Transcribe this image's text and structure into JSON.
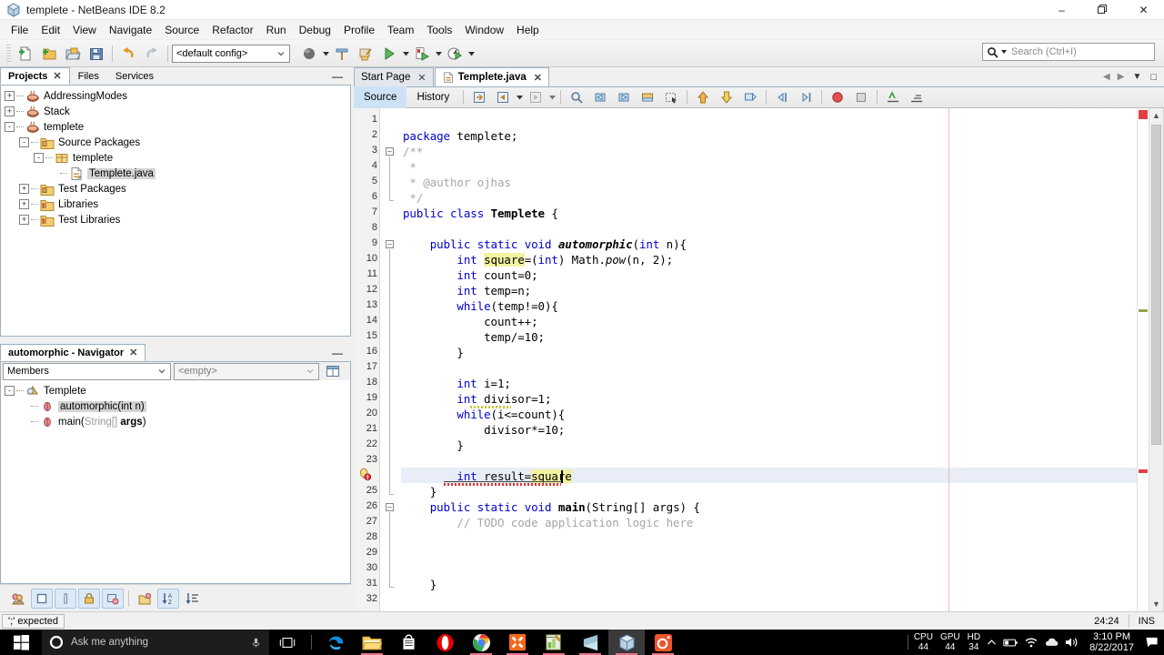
{
  "window": {
    "title": "templete - NetBeans IDE 8.2",
    "icon": "netbeans-cube-icon",
    "minimize": "–",
    "maximize": "❐",
    "close": "✕"
  },
  "menubar": {
    "items": [
      "File",
      "Edit",
      "View",
      "Navigate",
      "Source",
      "Refactor",
      "Run",
      "Debug",
      "Profile",
      "Team",
      "Tools",
      "Window",
      "Help"
    ]
  },
  "toolbar": {
    "config_value": "<default config>",
    "search_placeholder": "Search (Ctrl+I)",
    "buttons": [
      "new-file",
      "new-project",
      "open-project",
      "save-all",
      "undo",
      "redo"
    ]
  },
  "projects_panel": {
    "tabs": [
      {
        "label": "Projects",
        "active": true,
        "closable": true
      },
      {
        "label": "Files",
        "active": false,
        "closable": false
      },
      {
        "label": "Services",
        "active": false,
        "closable": false
      }
    ],
    "minimize": "—",
    "tree": [
      {
        "label": "AddressingModes",
        "indent": 0,
        "expander": "+",
        "icon": "java-project-icon",
        "selected": false
      },
      {
        "label": "Stack",
        "indent": 0,
        "expander": "+",
        "icon": "java-project-icon",
        "selected": false
      },
      {
        "label": "templete",
        "indent": 0,
        "expander": "-",
        "icon": "java-project-icon",
        "selected": false
      },
      {
        "label": "Source Packages",
        "indent": 1,
        "expander": "-",
        "icon": "source-packages-icon",
        "selected": false
      },
      {
        "label": "templete",
        "indent": 2,
        "expander": "-",
        "icon": "package-icon",
        "selected": false
      },
      {
        "label": "Templete.java",
        "indent": 3,
        "expander": "",
        "icon": "java-file-icon",
        "selected": true
      },
      {
        "label": "Test Packages",
        "indent": 1,
        "expander": "+",
        "icon": "test-packages-icon",
        "selected": false
      },
      {
        "label": "Libraries",
        "indent": 1,
        "expander": "+",
        "icon": "libraries-icon",
        "selected": false
      },
      {
        "label": "Test Libraries",
        "indent": 1,
        "expander": "+",
        "icon": "libraries-icon",
        "selected": false
      }
    ]
  },
  "navigator_panel": {
    "tab_label": "automorphic - Navigator",
    "minimize": "—",
    "scope_value": "Members",
    "filter_value": "<empty>",
    "tree": [
      {
        "label": "Templete",
        "indent": 0,
        "expander": "-",
        "icon": "class-icon",
        "selected": false,
        "type": "class"
      },
      {
        "label": "automorphic(int n)",
        "indent": 1,
        "expander": "",
        "icon": "method-icon",
        "selected": true,
        "type": "method"
      },
      {
        "label": "main(String[] args)",
        "indent": 1,
        "expander": "",
        "icon": "method-icon",
        "selected": false,
        "type": "method"
      }
    ],
    "bottom_buttons": [
      "filter-inherited-icon",
      "show-fields-icon",
      "show-constructors-icon",
      "show-protected-icon",
      "show-package-icon",
      "show-static-icon",
      "sort-alphabetically-icon",
      "sort-by-source-icon"
    ]
  },
  "editor": {
    "tabs": [
      {
        "label": "Start Page",
        "active": false,
        "icon": ""
      },
      {
        "label": "Templete.java",
        "active": true,
        "icon": "java-file-icon"
      }
    ],
    "view_buttons": [
      {
        "label": "Source",
        "active": true
      },
      {
        "label": "History",
        "active": false
      }
    ],
    "toolbar_icons": [
      "last-edit-icon",
      "back-icon",
      "forward-icon",
      "find-selection-icon",
      "previous-bookmark-icon",
      "next-bookmark-icon",
      "toggle-bookmark-icon",
      "select-rectangle-icon",
      "previous-error-icon",
      "next-error-icon",
      "toggle-highlight-icon",
      "shift-left-icon",
      "shift-right-icon",
      "toggle-breakpoint-icon",
      "stop-icon",
      "comment-icon",
      "uncomment-icon"
    ],
    "right_margin_column": 80
  },
  "code": {
    "language": "java",
    "first_line": 1,
    "last_visible_line": 32,
    "caret": "24:24",
    "insert_mode": "INS",
    "error_message": "';' expected",
    "error_line": 24,
    "current_line": 24,
    "highlighted_identifier": "square",
    "lines": [
      {
        "n": 1,
        "text": ""
      },
      {
        "n": 2,
        "text": "package templete;"
      },
      {
        "n": 3,
        "text": "/**"
      },
      {
        "n": 4,
        "text": " *"
      },
      {
        "n": 5,
        "text": " * @author ojhas"
      },
      {
        "n": 6,
        "text": " */"
      },
      {
        "n": 7,
        "text": "public class Templete {"
      },
      {
        "n": 8,
        "text": ""
      },
      {
        "n": 9,
        "text": "    public static void automorphic(int n){"
      },
      {
        "n": 10,
        "text": "        int square=(int) Math.pow(n, 2);"
      },
      {
        "n": 11,
        "text": "        int count=0;"
      },
      {
        "n": 12,
        "text": "        int temp=n;"
      },
      {
        "n": 13,
        "text": "        while(temp!=0){"
      },
      {
        "n": 14,
        "text": "            count++;"
      },
      {
        "n": 15,
        "text": "            temp/=10;"
      },
      {
        "n": 16,
        "text": "        }"
      },
      {
        "n": 17,
        "text": ""
      },
      {
        "n": 18,
        "text": "        int i=1;"
      },
      {
        "n": 19,
        "text": "        int divisor=1;"
      },
      {
        "n": 20,
        "text": "        while(i<=count){"
      },
      {
        "n": 21,
        "text": "            divisor*=10;"
      },
      {
        "n": 22,
        "text": "        }"
      },
      {
        "n": 23,
        "text": ""
      },
      {
        "n": 24,
        "text": "        int result=square"
      },
      {
        "n": 25,
        "text": "    }"
      },
      {
        "n": 26,
        "text": "    public static void main(String[] args) {"
      },
      {
        "n": 27,
        "text": "        // TODO code application logic here"
      },
      {
        "n": 28,
        "text": ""
      },
      {
        "n": 29,
        "text": ""
      },
      {
        "n": 30,
        "text": ""
      },
      {
        "n": 31,
        "text": "    }"
      },
      {
        "n": 32,
        "text": ""
      }
    ]
  },
  "colors": {
    "keyword": "#0000cc",
    "comment": "#a6a6a6",
    "highlight": "#f2f2a0",
    "current_line": "#e8edf7",
    "error": "#dd3333",
    "margin_guide": "#f0b8b8",
    "selection": "#d4d4d4"
  },
  "taskbar": {
    "start": "windows-logo-icon",
    "search_placeholder": "Ask me anything",
    "cortana_icon": "cortana-circle-icon",
    "mic_icon": "microphone-icon",
    "taskview_icon": "task-view-icon",
    "apps": [
      {
        "name": "edge-icon",
        "running": false,
        "active": false
      },
      {
        "name": "file-explorer-icon",
        "running": true,
        "active": false
      },
      {
        "name": "microsoft-store-icon",
        "running": false,
        "active": false
      },
      {
        "name": "opera-icon",
        "running": false,
        "active": false
      },
      {
        "name": "chrome-icon",
        "running": true,
        "active": false
      },
      {
        "name": "xampp-icon",
        "running": true,
        "active": false
      },
      {
        "name": "notepad-plus-icon",
        "running": true,
        "active": false
      },
      {
        "name": "sublime-text-icon",
        "running": true,
        "active": false
      },
      {
        "name": "netbeans-icon",
        "running": true,
        "active": true
      },
      {
        "name": "camera-icon",
        "running": true,
        "active": false
      }
    ],
    "tray": {
      "perf": [
        {
          "label": "CPU",
          "value": "44"
        },
        {
          "label": "GPU",
          "value": "44"
        },
        {
          "label": "HD",
          "value": "34"
        }
      ],
      "icons": [
        "show-hidden-icons-chevron",
        "battery-icon",
        "wifi-icon",
        "onedrive-icon",
        "volume-icon",
        "action-center-icon"
      ],
      "time": "3:10 PM",
      "date": "8/22/2017"
    }
  }
}
